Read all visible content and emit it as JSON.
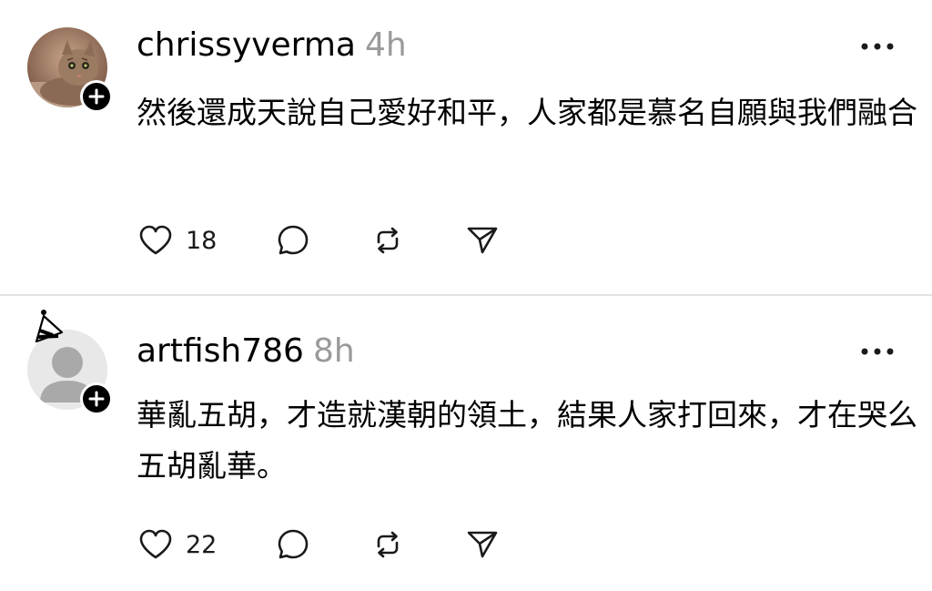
{
  "posts": [
    {
      "username": "chrissyverma",
      "time": "4h",
      "text": "然後還成天說自己愛好和平，人家都是慕名自願與我們融合",
      "likes": "18",
      "avatar": "cat-photo-avatar",
      "badge": "plus-icon"
    },
    {
      "username": "artfish786",
      "time": "8h",
      "text": "華亂五胡，才造就漢朝的領土，結果人家打回來，才在哭么五胡亂華。",
      "likes": "22",
      "avatar": "default-user-avatar",
      "badge": "plus-icon"
    }
  ],
  "icons": {
    "like": "heart-icon",
    "reply": "comment-bubble-icon",
    "repost": "repost-icon",
    "share": "send-icon",
    "more": "more-options-icon"
  },
  "colors": {
    "text": "#000000",
    "muted": "#9a9a9a",
    "divider": "#e3e3e3",
    "icon": "#1a1a1a"
  }
}
